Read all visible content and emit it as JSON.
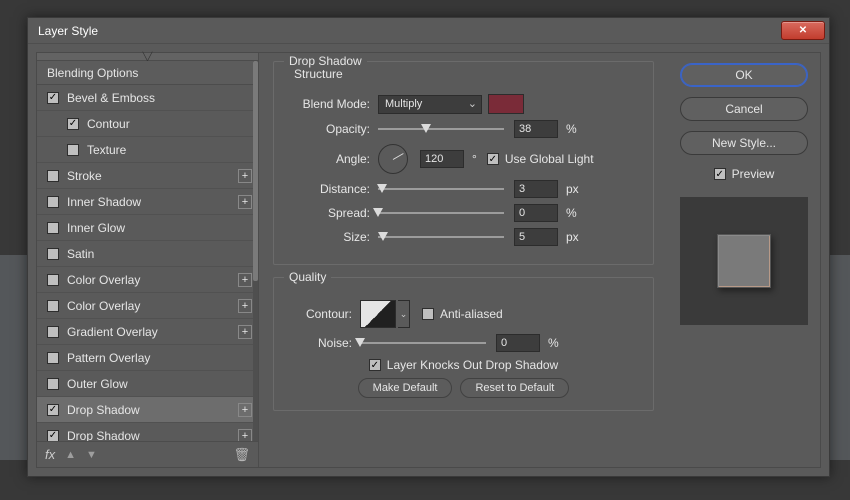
{
  "dialog": {
    "title": "Layer Style"
  },
  "left": {
    "header": "Blending Options",
    "items": [
      {
        "label": "Bevel & Emboss",
        "checked": true,
        "sub": false,
        "plus": false,
        "selected": false
      },
      {
        "label": "Contour",
        "checked": true,
        "sub": true,
        "plus": false,
        "selected": false
      },
      {
        "label": "Texture",
        "checked": false,
        "sub": true,
        "plus": false,
        "selected": false
      },
      {
        "label": "Stroke",
        "checked": false,
        "sub": false,
        "plus": true,
        "selected": false
      },
      {
        "label": "Inner Shadow",
        "checked": false,
        "sub": false,
        "plus": true,
        "selected": false
      },
      {
        "label": "Inner Glow",
        "checked": false,
        "sub": false,
        "plus": false,
        "selected": false
      },
      {
        "label": "Satin",
        "checked": false,
        "sub": false,
        "plus": false,
        "selected": false
      },
      {
        "label": "Color Overlay",
        "checked": false,
        "sub": false,
        "plus": true,
        "selected": false
      },
      {
        "label": "Color Overlay",
        "checked": false,
        "sub": false,
        "plus": true,
        "selected": false
      },
      {
        "label": "Gradient Overlay",
        "checked": false,
        "sub": false,
        "plus": true,
        "selected": false
      },
      {
        "label": "Pattern Overlay",
        "checked": false,
        "sub": false,
        "plus": false,
        "selected": false
      },
      {
        "label": "Outer Glow",
        "checked": false,
        "sub": false,
        "plus": false,
        "selected": false
      },
      {
        "label": "Drop Shadow",
        "checked": true,
        "sub": false,
        "plus": true,
        "selected": true
      },
      {
        "label": "Drop Shadow",
        "checked": true,
        "sub": false,
        "plus": true,
        "selected": false
      }
    ],
    "footer": {
      "fx": "fx"
    }
  },
  "main": {
    "section_title": "Drop Shadow",
    "structure_title": "Structure",
    "blend_mode": {
      "label": "Blend Mode:",
      "value": "Multiply",
      "swatch": "#7a2b38"
    },
    "opacity": {
      "label": "Opacity:",
      "value": "38",
      "unit": "%",
      "pos": 38
    },
    "angle": {
      "label": "Angle:",
      "value": "120",
      "unit": "°",
      "global_label": "Use Global Light",
      "global_checked": true
    },
    "distance": {
      "label": "Distance:",
      "value": "3",
      "unit": "px",
      "pos": 3
    },
    "spread": {
      "label": "Spread:",
      "value": "0",
      "unit": "%",
      "pos": 0
    },
    "size": {
      "label": "Size:",
      "value": "5",
      "unit": "px",
      "pos": 4
    },
    "quality_title": "Quality",
    "contour_label": "Contour:",
    "anti_alias": {
      "label": "Anti-aliased",
      "checked": false
    },
    "noise": {
      "label": "Noise:",
      "value": "0",
      "unit": "%",
      "pos": 0
    },
    "knockout": {
      "label": "Layer Knocks Out Drop Shadow",
      "checked": true
    },
    "make_default": "Make Default",
    "reset_default": "Reset to Default"
  },
  "right": {
    "ok": "OK",
    "cancel": "Cancel",
    "new_style": "New Style...",
    "preview_label": "Preview",
    "preview_checked": true
  }
}
